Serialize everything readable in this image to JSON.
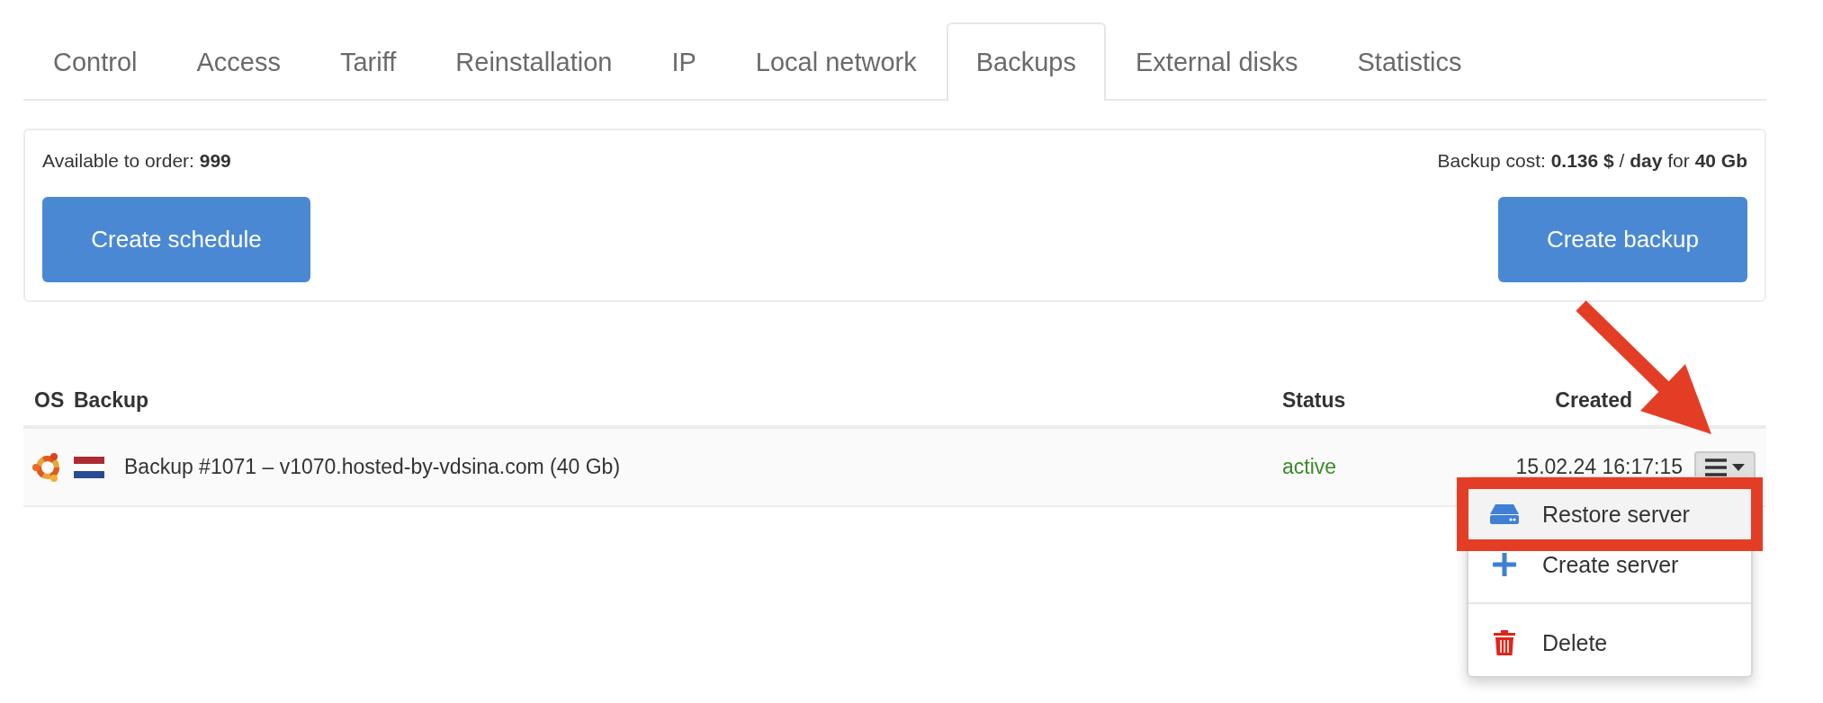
{
  "tabs": [
    {
      "label": "Control",
      "selected": false
    },
    {
      "label": "Access",
      "selected": false
    },
    {
      "label": "Tariff",
      "selected": false
    },
    {
      "label": "Reinstallation",
      "selected": false
    },
    {
      "label": "IP",
      "selected": false
    },
    {
      "label": "Local network",
      "selected": false
    },
    {
      "label": "Backups",
      "selected": true
    },
    {
      "label": "External disks",
      "selected": false
    },
    {
      "label": "Statistics",
      "selected": false
    }
  ],
  "summary": {
    "available": "Available to order: **999**",
    "cost": "Backup cost: **0.136 $** / **day** for **40 Gb**",
    "buttons": [
      {
        "label": "Create schedule",
        "kind": "schedule"
      },
      {
        "label": "Create backup",
        "kind": "backup"
      }
    ]
  },
  "table": {
    "columns": [
      "OS",
      "Backup",
      "Status",
      "Created"
    ],
    "rows": [
      {
        "backup": "Backup #1071 – v1070.hosted-by-vdsina.com (40 Gb)",
        "status": "active",
        "created": "15.02.24 16:17:15",
        "menu_open": true
      }
    ]
  },
  "menu": {
    "items": [
      {
        "kind": "restore",
        "label": "Restore server",
        "highlighted": true,
        "framed": true
      },
      {
        "kind": "create",
        "label": "Create server",
        "highlighted": false,
        "framed": false
      },
      {
        "kind": "delete",
        "label": "Delete",
        "highlighted": false,
        "framed": false
      }
    ]
  },
  "annotation_arrow": true
}
